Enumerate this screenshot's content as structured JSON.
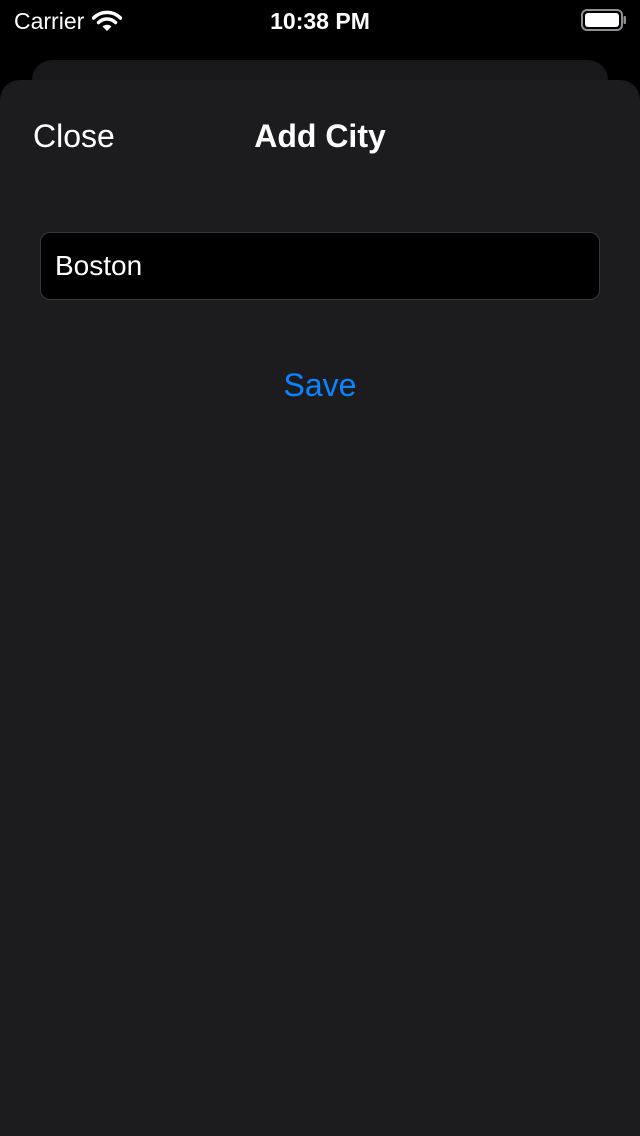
{
  "status_bar": {
    "carrier": "Carrier",
    "time": "10:38 PM",
    "icons": [
      "wifi-icon",
      "battery-icon"
    ]
  },
  "sheet": {
    "nav": {
      "close_label": "Close",
      "title": "Add City"
    },
    "city_field": {
      "value": "Boston",
      "placeholder": ""
    },
    "save_label": "Save"
  },
  "colors": {
    "background": "#000000",
    "sheet_background": "#1c1c1e",
    "input_background": "#000000",
    "input_border": "#38383a",
    "accent": "#0a84ff",
    "text": "#ffffff"
  }
}
